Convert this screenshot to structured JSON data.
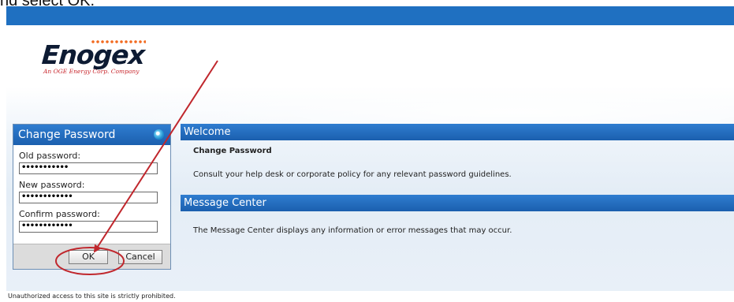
{
  "caption": "nd select OK.",
  "logo": {
    "name": "Enogex",
    "tagline": "An OGE Energy Corp. Company"
  },
  "change_password_panel": {
    "title": "Change Password",
    "old_password_label": "Old password:",
    "old_password_value": "•••••••••••",
    "new_password_label": "New password:",
    "new_password_value": "••••••••••••",
    "confirm_password_label": "Confirm password:",
    "confirm_password_value": "••••••••••••",
    "ok_label": "OK",
    "cancel_label": "Cancel"
  },
  "welcome": {
    "header": "Welcome",
    "title": "Change Password",
    "text": "Consult your help desk or corporate policy for any relevant password guidelines."
  },
  "message_center": {
    "header": "Message Center",
    "text": "The Message Center displays any information or error messages that may occur."
  },
  "footer": {
    "text": "Unauthorized access to this site is strictly prohibited."
  },
  "colors": {
    "header_blue": "#1f70c1",
    "annotation_red": "#c0272d"
  }
}
